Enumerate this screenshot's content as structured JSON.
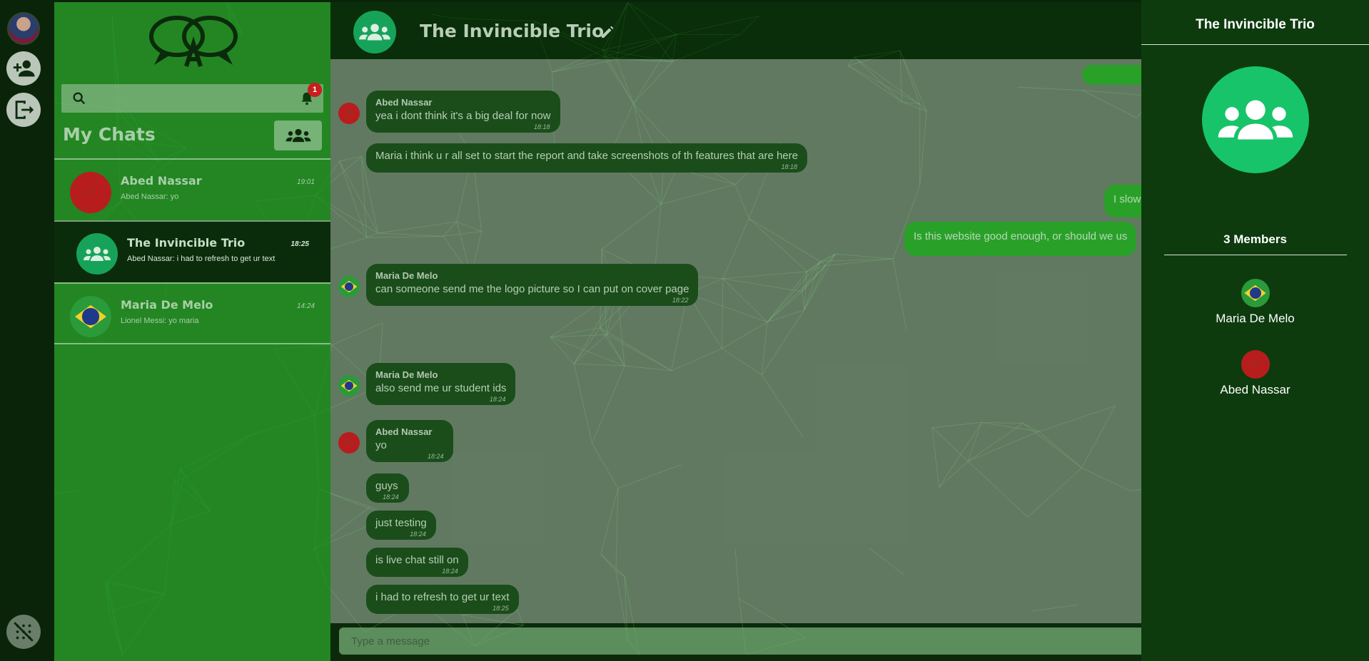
{
  "colors": {
    "accent_green": "#17c46a",
    "sidebar_green": "#289b28",
    "dark_green": "#0d3b0d",
    "badge_red": "#c81e1e"
  },
  "rail": {
    "profile_avatar_label": "profile-avatar",
    "icons": [
      "add-user-icon",
      "logout-icon",
      "network-toggle-icon"
    ]
  },
  "sidebar": {
    "search_placeholder": "",
    "notification_count": "1",
    "title": "My Chats",
    "chats": [
      {
        "name": "Abed Nassar",
        "preview": "Abed Nassar: yo",
        "time": "19:01",
        "avatar": "morocco-flag"
      },
      {
        "name": "The Invincible Trio",
        "preview": "Abed Nassar: i had to refresh to get ur text",
        "time": "18:25",
        "avatar": "group-icon"
      },
      {
        "name": "Maria De Melo",
        "preview": "Lionel Messi: yo maria",
        "time": "14:24",
        "avatar": "brazil-flag"
      }
    ]
  },
  "chat": {
    "title": "The Invincible Trio",
    "composer_placeholder": "Type a message",
    "messages": [
      {
        "sender": "Abed Nassar",
        "text": "yea i dont think it's a big deal for now",
        "time": "18:18"
      },
      {
        "sender": "",
        "text": "Maria i think u r all set to start the report and take screenshots of th features that are here",
        "time": "18:18"
      },
      {
        "sender": "",
        "text": "I slow",
        "time": ""
      },
      {
        "sender": "",
        "text": "Is this website good enough, or should we us",
        "time": ""
      },
      {
        "sender": "Maria De Melo",
        "text": "can someone send me the logo picture so I can put on cover page",
        "time": "18:22"
      },
      {
        "sender": "Maria De Melo",
        "text": "also send me ur student ids",
        "time": "18:24"
      },
      {
        "sender": "Abed Nassar",
        "text": "yo",
        "time": "18:24"
      },
      {
        "sender": "",
        "text": "guys",
        "time": "18:24"
      },
      {
        "sender": "",
        "text": "just testing",
        "time": "18:24"
      },
      {
        "sender": "",
        "text": "is live chat still on",
        "time": "18:24"
      },
      {
        "sender": "",
        "text": "i had to refresh to get ur text",
        "time": "18:25"
      }
    ]
  },
  "info_panel": {
    "title": "The Invincible Trio",
    "members_count": "3 Members",
    "members": [
      {
        "name": "Maria De Melo",
        "avatar": "brazil-flag"
      },
      {
        "name": "Abed Nassar",
        "avatar": "morocco-flag"
      }
    ]
  }
}
